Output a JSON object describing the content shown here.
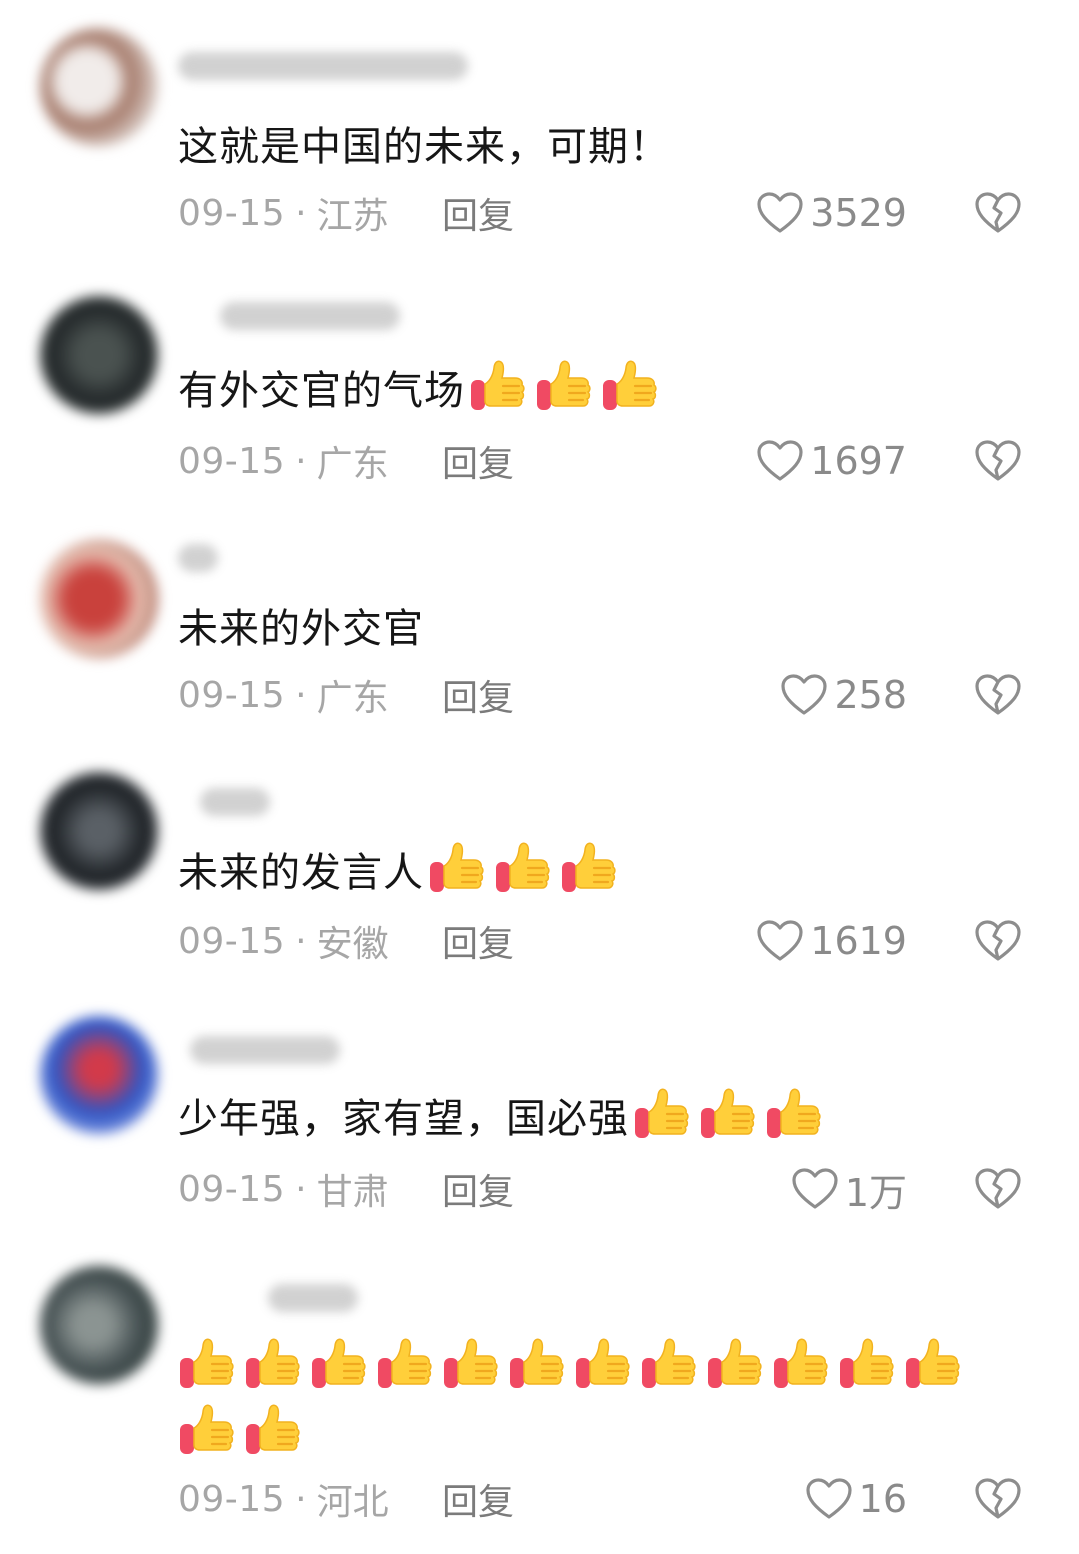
{
  "comments": [
    {
      "text": "这就是中国的未来，可期！",
      "thumbs_inline": 0,
      "date": "09-15",
      "separator": "·",
      "location": "江苏",
      "reply_label": "回复",
      "likes": "3529",
      "avatar_colors": [
        "#d9cfc9",
        "#9a6e62",
        "#e9e4e2"
      ]
    },
    {
      "text": "有外交官的气场",
      "thumbs_inline": 3,
      "date": "09-15",
      "separator": "·",
      "location": "广东",
      "reply_label": "回复",
      "likes": "1697",
      "avatar_colors": [
        "#2b2f30",
        "#4d5552",
        "#1c1f20"
      ]
    },
    {
      "text": "未来的外交官",
      "thumbs_inline": 0,
      "date": "09-15",
      "separator": "·",
      "location": "广东",
      "reply_label": "回复",
      "likes": "258",
      "avatar_colors": [
        "#c9413c",
        "#e7c4b6",
        "#8f4a3e"
      ]
    },
    {
      "text": "未来的发言人",
      "thumbs_inline": 3,
      "date": "09-15",
      "separator": "·",
      "location": "安徽",
      "reply_label": "回复",
      "likes": "1619",
      "avatar_colors": [
        "#1e2226",
        "#3a3f44",
        "#565c61"
      ]
    },
    {
      "text": "少年强，家有望，国必强",
      "thumbs_inline": 3,
      "date": "09-15",
      "separator": "·",
      "location": "甘肃",
      "reply_label": "回复",
      "likes": "1万",
      "avatar_colors": [
        "#2e55c4",
        "#d23a4a",
        "#7d93e0"
      ]
    },
    {
      "text": "",
      "thumbs_inline": 0,
      "thumbs_block": 14,
      "date": "09-15",
      "separator": "·",
      "location": "河北",
      "reply_label": "回复",
      "likes": "16",
      "avatar_colors": [
        "#5a6466",
        "#2d3a38",
        "#8b9492"
      ]
    }
  ],
  "icons": {
    "like": "heart-outline-icon",
    "dislike": "broken-heart-icon",
    "emoji": "thumbs-up-emoji"
  }
}
